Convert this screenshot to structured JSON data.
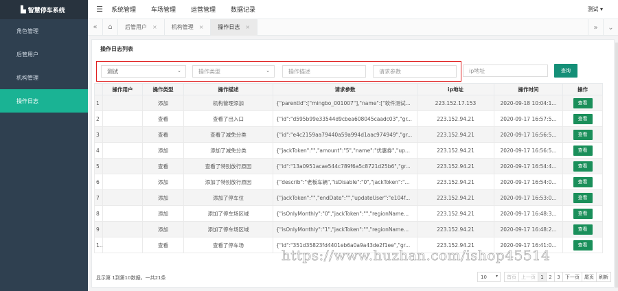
{
  "app": {
    "title": "智慧停车系统"
  },
  "sidebar": {
    "items": [
      {
        "label": "角色管理"
      },
      {
        "label": "后管用户"
      },
      {
        "label": "机构管理"
      },
      {
        "label": "操作日志",
        "active": true
      }
    ]
  },
  "topnav": {
    "items": [
      {
        "label": "系统管理"
      },
      {
        "label": "车场管理"
      },
      {
        "label": "运营管理"
      },
      {
        "label": "数据记录"
      }
    ],
    "user": "测试 ▾"
  },
  "tabs": [
    {
      "label": "后管用户"
    },
    {
      "label": "机构管理"
    },
    {
      "label": "操作日志",
      "active": true
    }
  ],
  "panel": {
    "title": "操作日志列表"
  },
  "filters": {
    "user": "测试",
    "type_placeholder": "操作类型",
    "desc_placeholder": "操作描述",
    "params_placeholder": "请求参数",
    "ip_placeholder": "ip地址",
    "query_label": "查询"
  },
  "table": {
    "headers": [
      "操作用户",
      "操作类型",
      "操作描述",
      "请求参数",
      "ip地址",
      "操作时间",
      "操作"
    ],
    "action_label": "查看",
    "rows": [
      {
        "idx": "1",
        "user": "",
        "type": "添加",
        "desc": "机构管理添加",
        "params": "{\"parentId\":[\"mingbo_001007\"],\"name\":[\"软件测试...",
        "ip": "223.152.17.153",
        "time": "2020-09-18 10:04:1..."
      },
      {
        "idx": "2",
        "user": "",
        "type": "查看",
        "desc": "查看了出入口",
        "params": "{\"id\":\"d595b99e33544d9cbea608045caadc03\",\"gr...",
        "ip": "223.152.94.21",
        "time": "2020-09-17 16:57:5..."
      },
      {
        "idx": "3",
        "user": "",
        "type": "查看",
        "desc": "查看了减免分类",
        "params": "{\"id\":\"e4c2159aa79440a59a994d1aac974949\",\"gr...",
        "ip": "223.152.94.21",
        "time": "2020-09-17 16:56:5..."
      },
      {
        "idx": "4",
        "user": "",
        "type": "添加",
        "desc": "添加了减免分类",
        "params": "{\"jackToken\":\"\",\"amount\":\"5\",\"name\":\"优惠券\",\"up...",
        "ip": "223.152.94.21",
        "time": "2020-09-17 16:56:5..."
      },
      {
        "idx": "5",
        "user": "",
        "type": "查看",
        "desc": "查看了特别放行原因",
        "params": "{\"id\":\"13a0951acae544c789f6a5c8721d25b6\",\"gr...",
        "ip": "223.152.94.21",
        "time": "2020-09-17 16:54:4..."
      },
      {
        "idx": "6",
        "user": "",
        "type": "添加",
        "desc": "添加了特别放行原因",
        "params": "{\"describ\":\"老板车辆\",\"isDisable\":\"0\",\"jackToken\":\"...",
        "ip": "223.152.94.21",
        "time": "2020-09-17 16:54:0..."
      },
      {
        "idx": "7",
        "user": "",
        "type": "添加",
        "desc": "添加了停车位",
        "params": "{\"jackToken\":\"\",\"endDate\":\"\",\"updateUser\":\"e104f...",
        "ip": "223.152.94.21",
        "time": "2020-09-17 16:53:0..."
      },
      {
        "idx": "8",
        "user": "",
        "type": "添加",
        "desc": "添加了停车场区域",
        "params": "{\"isOnlyMonthly\":\"0\",\"jackToken\":\"\",\"regionName...",
        "ip": "223.152.94.21",
        "time": "2020-09-17 16:48:3..."
      },
      {
        "idx": "9",
        "user": "",
        "type": "添加",
        "desc": "添加了停车场区域",
        "params": "{\"isOnlyMonthly\":\"1\",\"jackToken\":\"\",\"regionName...",
        "ip": "223.152.94.21",
        "time": "2020-09-17 16:48:2..."
      },
      {
        "idx": "10",
        "user": "",
        "type": "查看",
        "desc": "查看了停车场",
        "params": "{\"id\":\"351d35823fd4401eb6a0a9a43de2f1ee\",\"gr...",
        "ip": "223.152.94.21",
        "time": "2020-09-17 16:41:0..."
      }
    ]
  },
  "pagination": {
    "summary": "显示第 1到第10数据，一共21条",
    "page_size": "10",
    "first": "首页",
    "prev": "上一页",
    "pages": [
      "1",
      "2",
      "3"
    ],
    "next": "下一页",
    "last": "尾页",
    "refresh": "刷新"
  },
  "watermark": "https://www.huzhan.com/ishop45514"
}
